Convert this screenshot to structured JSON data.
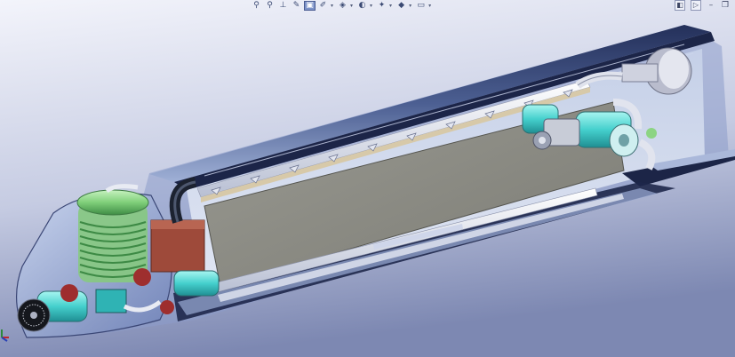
{
  "app": {
    "name": "CAD 3D model viewport"
  },
  "toolbar": {
    "items": [
      {
        "id": "search",
        "icon": "magnifier-icon"
      },
      {
        "id": "zoom-area",
        "icon": "zoom-area-icon"
      },
      {
        "id": "section",
        "icon": "section-view-icon"
      },
      {
        "id": "dynamic",
        "icon": "dynamic-annotation-icon"
      },
      {
        "id": "view-orientation",
        "icon": "view-orientation-icon",
        "active": true
      },
      {
        "id": "display-style",
        "icon": "display-style-icon"
      },
      {
        "id": "hide-show",
        "icon": "hide-show-items-icon"
      },
      {
        "id": "edit-appearance",
        "icon": "edit-appearance-icon"
      },
      {
        "id": "scenes",
        "icon": "apply-scene-icon"
      },
      {
        "id": "view-settings",
        "icon": "view-settings-icon"
      },
      {
        "id": "monitor",
        "icon": "monitor-icon"
      }
    ],
    "glyphs": [
      "⚲",
      "⚲",
      "⊥",
      "✎",
      "▣",
      "✐",
      "◈",
      "◐",
      "✦",
      "◆",
      "▭"
    ]
  },
  "window": {
    "controls": [
      "◧",
      "▷",
      "–",
      "❐"
    ]
  },
  "colors": {
    "background_top": "#eef0f9",
    "background_bottom": "#7f8bb6",
    "shell_glass": "#9fb3d8",
    "shell_dark": "#1a2140",
    "plate": "#8e8e86",
    "coil_green": "#8cd483",
    "duct_cyan": "#4fd6d3",
    "block_red": "#9e4a3a"
  }
}
